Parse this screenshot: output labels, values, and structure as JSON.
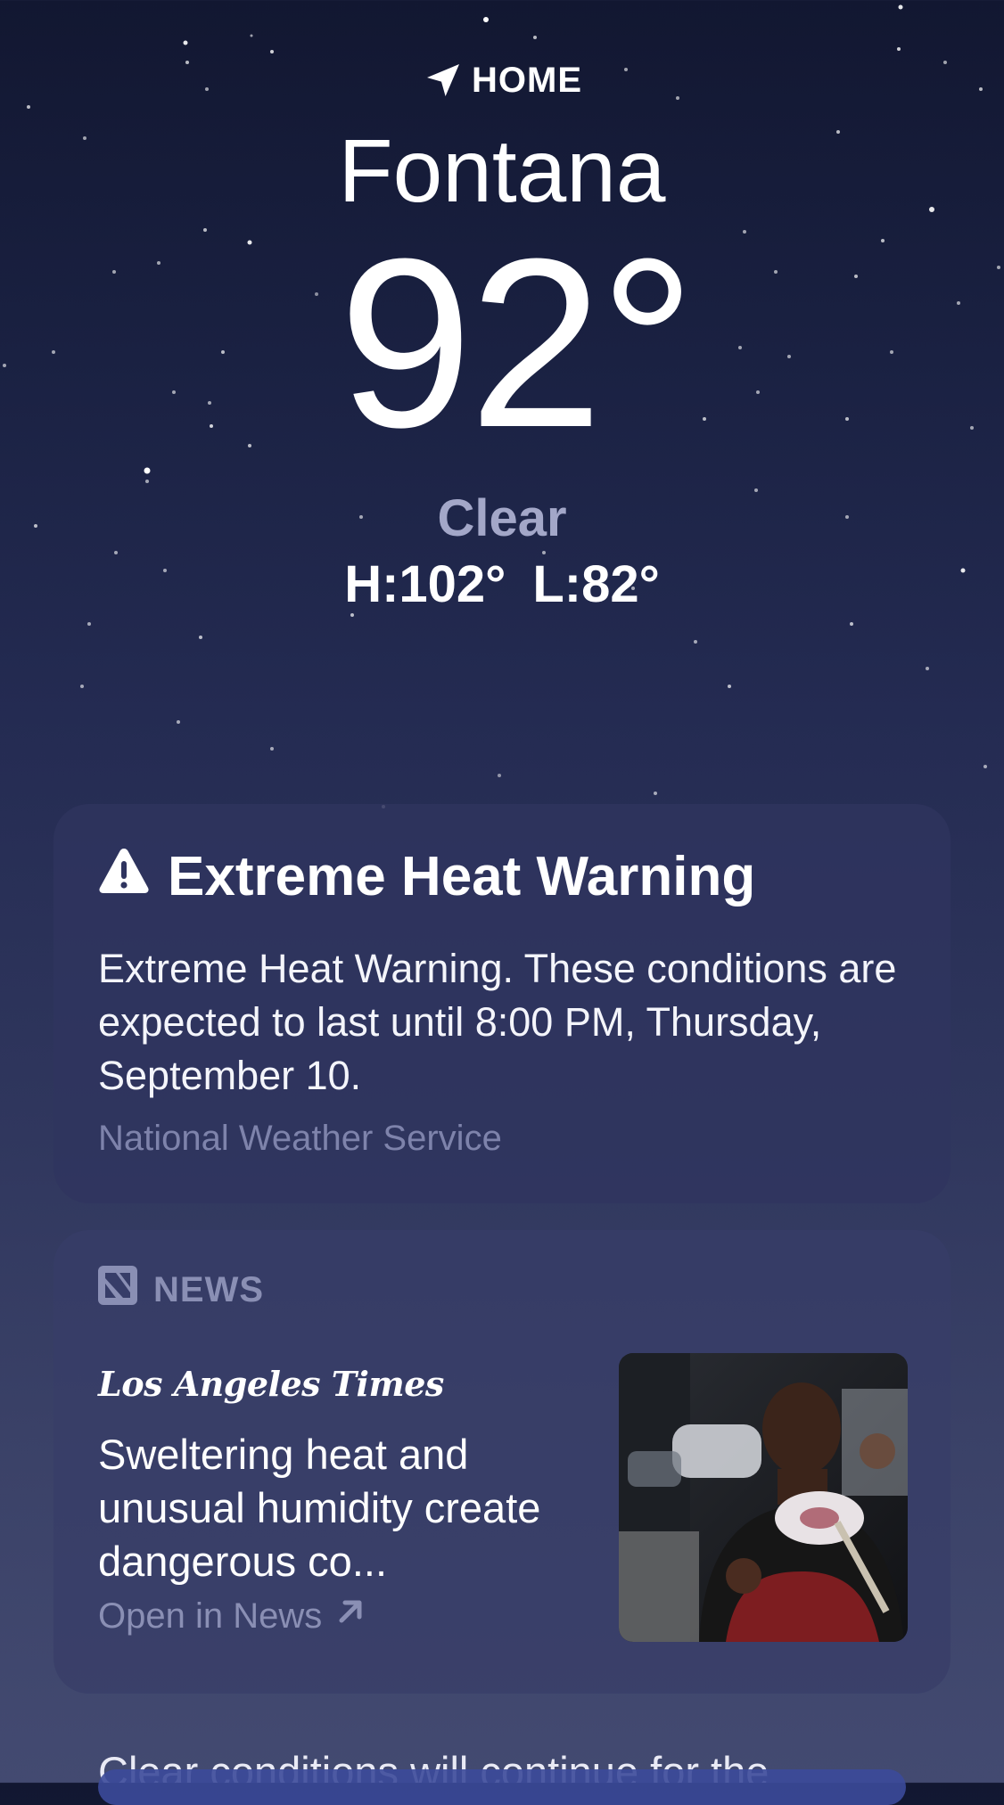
{
  "header": {
    "location_label": "HOME",
    "city": "Fontana",
    "temperature": "92°",
    "condition": "Clear",
    "high": "H:102°",
    "low": "L:82°"
  },
  "alert": {
    "title": "Extreme Heat Warning",
    "body": "Extreme Heat Warning. These conditions are expected to last until 8:00 PM, Thursday, September 10.",
    "source": "National Weather Service",
    "icon": "warning-triangle-icon"
  },
  "news": {
    "label": "NEWS",
    "icon": "apple-news-icon",
    "publisher": "Los Angeles Times",
    "headline": "Sweltering heat and unusual humidity create dangerous co...",
    "open_link": "Open in News",
    "open_icon": "arrow-up-right-icon"
  },
  "forecast": {
    "summary": "Clear conditions will continue for the"
  },
  "colors": {
    "background_top": "#121731",
    "background_bottom": "#434a71",
    "card": "#2f345f",
    "secondary_text": "#8a8fb4",
    "condition_text": "#a3a7c8"
  }
}
